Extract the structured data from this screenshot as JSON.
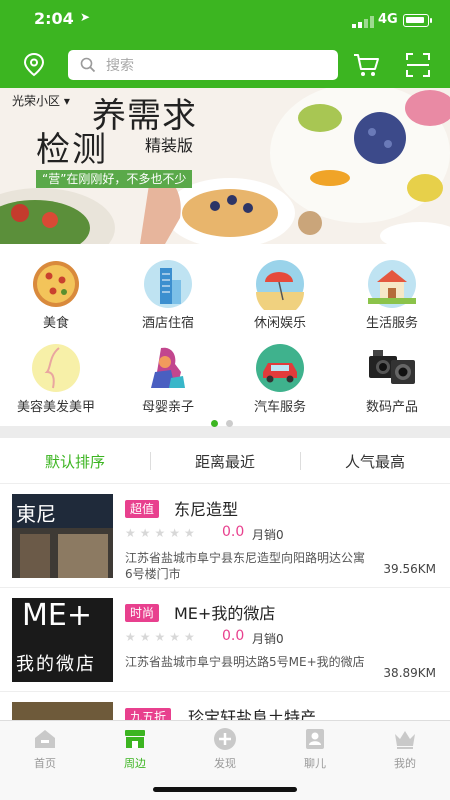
{
  "status": {
    "time": "2:04",
    "network": "4G"
  },
  "header": {
    "search_placeholder": "搜索"
  },
  "banner": {
    "location": "光荣小区",
    "title_line1": "养需求",
    "title_line2": "检测",
    "subtitle": "精装版",
    "tagline": "“营”在刚刚好，不多也不少"
  },
  "categories": [
    {
      "label": "美食",
      "icon": "pizza-icon"
    },
    {
      "label": "酒店住宿",
      "icon": "hotel-icon"
    },
    {
      "label": "休闲娱乐",
      "icon": "beach-icon"
    },
    {
      "label": "生活服务",
      "icon": "house-icon"
    },
    {
      "label": "美容美发美甲",
      "icon": "face-icon"
    },
    {
      "label": "母婴亲子",
      "icon": "mother-child-icon"
    },
    {
      "label": "汽车服务",
      "icon": "car-icon"
    },
    {
      "label": "数码产品",
      "icon": "camera-icon"
    }
  ],
  "pager": {
    "pages": 2,
    "current": 1
  },
  "sort_tabs": [
    {
      "label": "默认排序",
      "active": true
    },
    {
      "label": "距离最近",
      "active": false
    },
    {
      "label": "人气最高",
      "active": false
    }
  ],
  "shops": [
    {
      "badge": "超值",
      "name": "东尼造型",
      "score": "0.0",
      "sales": "月销0",
      "address": "江苏省盐城市阜宁县东尼造型向阳路明达公寓6号楼门市",
      "distance": "39.56KM",
      "image_text": "東尼"
    },
    {
      "badge": "时尚",
      "name": "ME+我的微店",
      "score": "0.0",
      "sales": "月销0",
      "address": "江苏省盐城市阜宁县明达路5号ME+我的微店",
      "distance": "38.89KM",
      "image_text_top": "ME+",
      "image_text_bottom": "我的微店"
    },
    {
      "badge": "九五折",
      "name": "珍宝轩盐阜土特产"
    }
  ],
  "tabbar": [
    {
      "label": "首页",
      "active": false
    },
    {
      "label": "周边",
      "active": true
    },
    {
      "label": "发现",
      "active": false
    },
    {
      "label": "聊儿",
      "active": false
    },
    {
      "label": "我的",
      "active": false
    }
  ],
  "colors": {
    "brand_green": "#3cb521",
    "badge_pink": "#e8408e"
  }
}
